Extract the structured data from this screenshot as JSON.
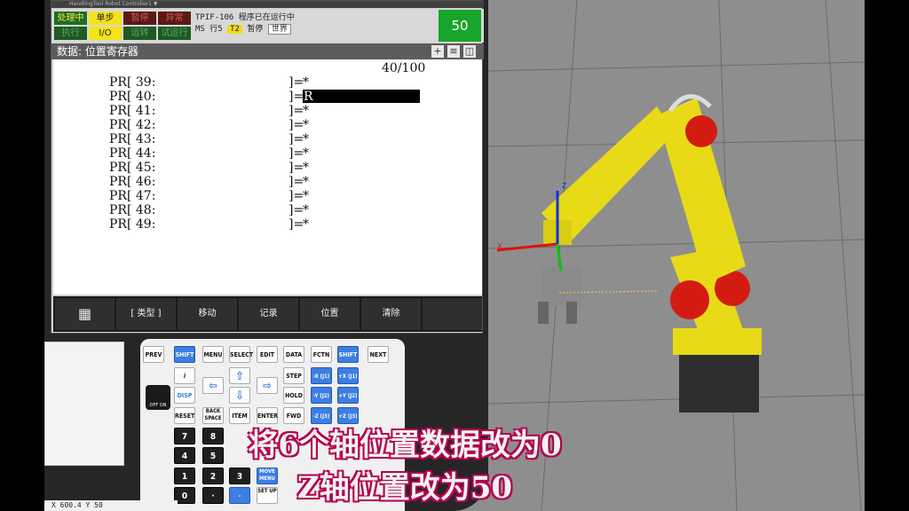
{
  "title_strip": "HandlingTool  Robot Controller1 ▼",
  "status_indicators": [
    {
      "label": "处理中",
      "style": "green-lit"
    },
    {
      "label": "单步",
      "style": "yellow"
    },
    {
      "label": "暂停",
      "style": "red"
    },
    {
      "label": "异常",
      "style": "red"
    },
    {
      "label": "执行",
      "style": "green"
    },
    {
      "label": "I/O",
      "style": "yellow"
    },
    {
      "label": "运转",
      "style": "green"
    },
    {
      "label": "试运行",
      "style": "green"
    }
  ],
  "status_info": {
    "line1": "TPIF-106 程序已在运行中",
    "program": "MS",
    "line_text": "行5",
    "mode": "T2",
    "state": "暂停",
    "frame": "世界"
  },
  "override": "50",
  "screen_title": "数据: 位置寄存器",
  "title_icons": [
    "+",
    "≡",
    "◫"
  ],
  "page_counter": "40/100",
  "position_registers": [
    {
      "label": "PR[ 39:",
      "end": "]=",
      "value": "*"
    },
    {
      "label": "PR[ 40:",
      "end": "]=",
      "value": "R"
    },
    {
      "label": "PR[ 41:",
      "end": "]=",
      "value": "*"
    },
    {
      "label": "PR[ 42:",
      "end": "]=",
      "value": "*"
    },
    {
      "label": "PR[ 43:",
      "end": "]=",
      "value": "*"
    },
    {
      "label": "PR[ 44:",
      "end": "]=",
      "value": "*"
    },
    {
      "label": "PR[ 45:",
      "end": "]=",
      "value": "*"
    },
    {
      "label": "PR[ 46:",
      "end": "]=",
      "value": "*"
    },
    {
      "label": "PR[ 47:",
      "end": "]=",
      "value": "*"
    },
    {
      "label": "PR[ 48:",
      "end": "]=",
      "value": "*"
    },
    {
      "label": "PR[ 49:",
      "end": "]=",
      "value": "*"
    }
  ],
  "function_keys": [
    "▦",
    "[ 类型 ]",
    "移动",
    "记录",
    "位置",
    "清除",
    ""
  ],
  "keypad": {
    "row1": [
      "PREV",
      "SHIFT",
      "MENU",
      "SELECT",
      "EDIT",
      "DATA",
      "FCTN",
      "SHIFT",
      "NEXT"
    ],
    "info": "i",
    "disp": "DISP",
    "reset": "RESET",
    "backspace": "BACK SPACE",
    "item": "ITEM",
    "enter": "ENTER",
    "fwd": "FWD",
    "step": "STEP",
    "hold": "HOLD",
    "move_menu": "MOVE MENU",
    "setup": "SET UP",
    "jog": [
      "-X (J1)",
      "+X (J1)",
      "-Y (J2)",
      "+Y (J2)",
      "-Z (J3)",
      "+Z (J3)"
    ],
    "digits": [
      "7",
      "8",
      "4",
      "5",
      "1",
      "2",
      "3",
      "0",
      "·",
      "-"
    ],
    "estop": "OFF ON"
  },
  "axis_labels": {
    "x": "X",
    "z": "Z"
  },
  "caption_line1": "将6个轴位置数据改为0",
  "caption_line2": "Z轴位置改为50",
  "coords": "X 600.4 Y 50"
}
